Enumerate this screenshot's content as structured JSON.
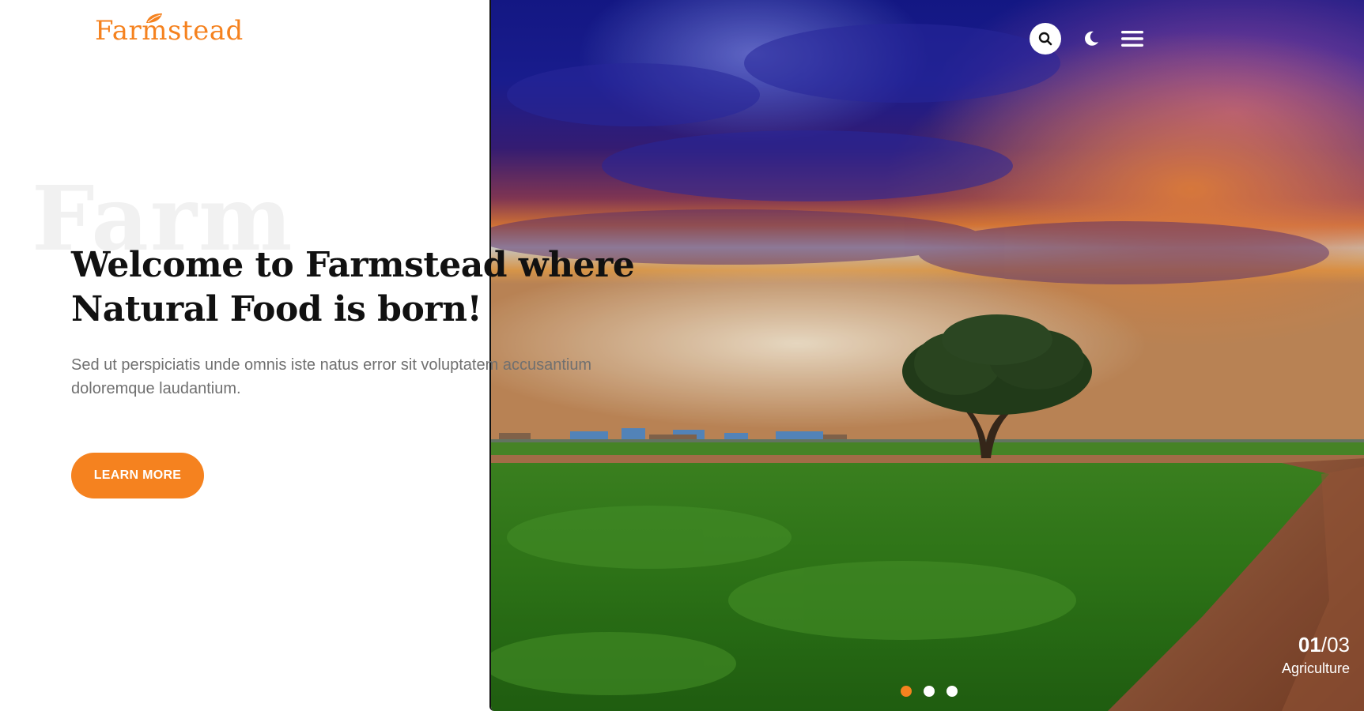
{
  "brand": {
    "name": "Farmstead",
    "accent_color": "#f5821f"
  },
  "header": {
    "icons": [
      "search-icon",
      "moon-icon",
      "menu-icon"
    ]
  },
  "hero": {
    "background_word": "Farm",
    "headline": "Welcome to Farmstead where Natural Food is born!",
    "subtext": "Sed ut perspiciatis unde omnis iste natus error sit voluptatem accusantium doloremque laudantium.",
    "cta_label": "LEARN MORE"
  },
  "slider": {
    "current": "01",
    "separator": "/",
    "total": "03",
    "caption": "Agriculture",
    "dot_count": 3,
    "active_index": 0
  }
}
